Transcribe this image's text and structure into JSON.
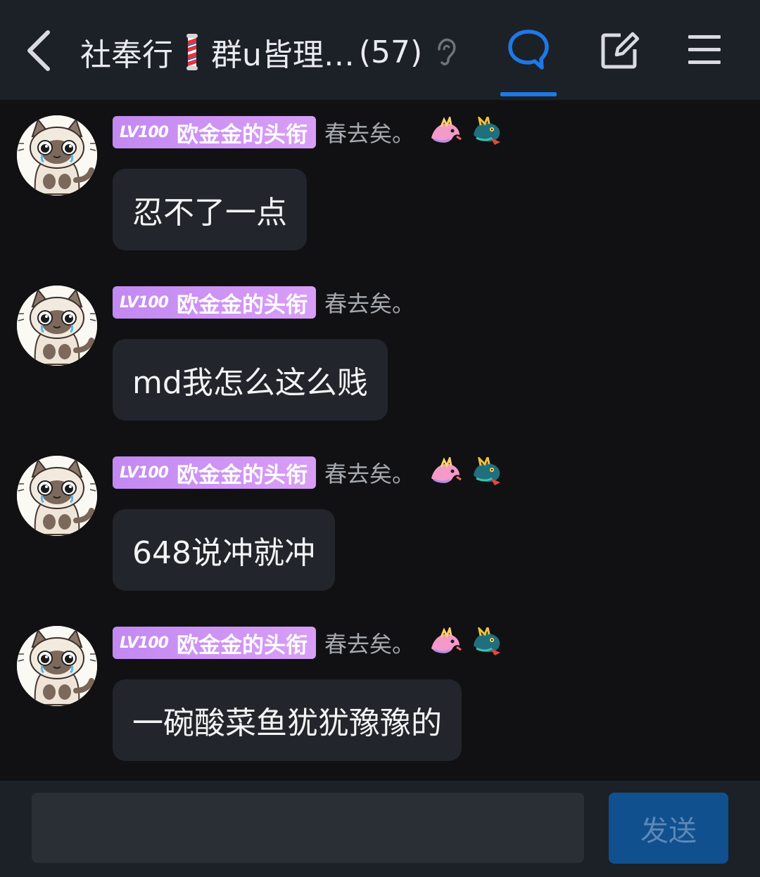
{
  "header": {
    "title_part1": "社奉行",
    "title_part2": "群u皆理…",
    "member_count": "(57)",
    "icons": [
      "back-arrow-icon",
      "barber-pole-icon",
      "ear-icon",
      "chat-bubble-icon",
      "edit-icon",
      "menu-icon"
    ],
    "accent_color": "#1e78e6"
  },
  "messages": [
    {
      "badge_level": "LV100",
      "badge_title": "欧金金的头衔",
      "username": "春去矣。",
      "has_decorations": true,
      "text": "忍不了一点"
    },
    {
      "badge_level": "LV100",
      "badge_title": "欧金金的头衔",
      "username": "春去矣。",
      "has_decorations": false,
      "text": "md我怎么这么贱"
    },
    {
      "badge_level": "LV100",
      "badge_title": "欧金金的头衔",
      "username": "春去矣。",
      "has_decorations": true,
      "text": "648说冲就冲"
    },
    {
      "badge_level": "LV100",
      "badge_title": "欧金金的头衔",
      "username": "春去矣。",
      "has_decorations": true,
      "text": "一碗酸菜鱼犹犹豫豫的"
    }
  ],
  "footer": {
    "input_value": "",
    "send_label": "发送",
    "send_color": "#10508f"
  }
}
